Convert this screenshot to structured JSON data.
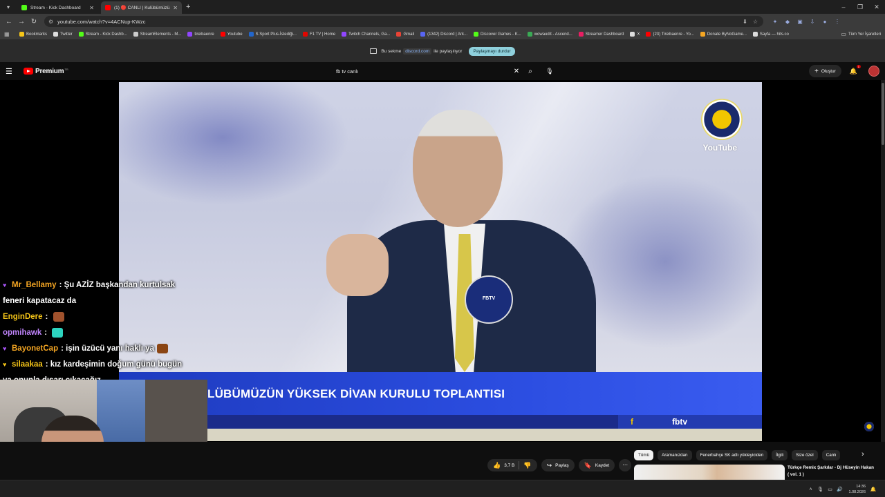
{
  "browser": {
    "tabs": [
      {
        "title": "Stream - Kick Dashboard",
        "active": false,
        "favicon_color": "#53fc18"
      },
      {
        "title": "(1) 🔴 CANLI | Kulübümüzü...",
        "active": true,
        "favicon_color": "#ff0000"
      }
    ],
    "url": "youtube.com/watch?v=4ACNup-KWzc",
    "bookmarks": [
      {
        "label": "Bookmarks",
        "color": "#f5c518"
      },
      {
        "label": "Twitter",
        "color": "#dddddd"
      },
      {
        "label": "Stream - Kick Dashb...",
        "color": "#53fc18"
      },
      {
        "label": "StreamElements - M...",
        "color": "#cccccc"
      },
      {
        "label": "tireibaenre",
        "color": "#9146ff"
      },
      {
        "label": "Youtube",
        "color": "#ff0000"
      },
      {
        "label": "S Sport Plus-İstediği...",
        "color": "#2266cc"
      },
      {
        "label": "F1 TV | Home",
        "color": "#e10600"
      },
      {
        "label": "Twitch Channels, Ga...",
        "color": "#9146ff"
      },
      {
        "label": "Gmail",
        "color": "#ea4335"
      },
      {
        "label": "(1342) Discord | Ark...",
        "color": "#5865f2"
      },
      {
        "label": "Discover Games - K...",
        "color": "#53fc18"
      },
      {
        "label": "wowaudit - Ascend...",
        "color": "#3aaa55"
      },
      {
        "label": "Streamer Dashboard",
        "color": "#e91e63"
      },
      {
        "label": "X",
        "color": "#dddddd"
      },
      {
        "label": "(23) Tireibaenre - Yo...",
        "color": "#ff0000"
      },
      {
        "label": "Donate ByNoGame...",
        "color": "#f5a623"
      },
      {
        "label": "Sayfa — hits.co",
        "color": "#dddddd"
      }
    ],
    "all_bookmarks": "Tüm Yer İşaretleri",
    "sharing": {
      "text_before": "Bu sekme",
      "domain": "discord.com",
      "text_after": "ile paylaşılıyor",
      "stop_button": "Paylaşmayı durdur"
    }
  },
  "youtube": {
    "brand": "Premium",
    "country_code": "TR",
    "search_query": "fb tv canlı",
    "create_label": "Oluştur",
    "notification_count": "1",
    "video": {
      "lower_third": "LÜBÜMÜZÜN YÜKSEK DİVAN KURULU TOPLANTISI",
      "channel_mark": "fbtv",
      "watermark": "YouTube",
      "mic_label": "FBTV"
    },
    "actions": {
      "likes": "3,7 B",
      "share": "Paylaş",
      "save": "Kaydet"
    },
    "chips": [
      "Tümü",
      "Aramanızdan",
      "Fenerbahçe SK adlı yükleyiciden",
      "İlgili",
      "Size özel",
      "Canlı"
    ],
    "recommendation_title": "Türkçe Remix Şarkılar - Dj Hüseyin Hakan ( vol. 1 )"
  },
  "chat": [
    {
      "user": "Mr_Bellamy",
      "color": "#f5a623",
      "badge": "♥",
      "badge_color": "#a855f7",
      "message": "Şu AZİZ başkandan kurtulsak"
    },
    {
      "user": "",
      "color": "#ffffff",
      "badge": "",
      "badge_color": "",
      "message": "feneri kapatacaz da"
    },
    {
      "user": "EnginDere",
      "color": "#f5c518",
      "badge": "",
      "badge_color": "",
      "message": "",
      "emote": "#a0522d"
    },
    {
      "user": "opmihawk",
      "color": "#c084fc",
      "badge": "",
      "badge_color": "",
      "message": "",
      "emote": "#2dd4bf"
    },
    {
      "user": "BayonetCap",
      "color": "#f5a623",
      "badge": "♥",
      "badge_color": "#a855f7",
      "message": "işin üzücü yanı haklı ya",
      "emote": "#8b4513"
    },
    {
      "user": "silaakaa",
      "color": "#f5c518",
      "badge": "♥",
      "badge_color": "#f5c518",
      "message": "kız kardeşimin doğum günü bugün"
    },
    {
      "user": "",
      "color": "#ffffff",
      "badge": "",
      "badge_color": "",
      "message": "ya onunla dışarı çıkacağız"
    }
  ],
  "taskbar": {
    "time": "14:36",
    "date": "1.08.2026"
  }
}
